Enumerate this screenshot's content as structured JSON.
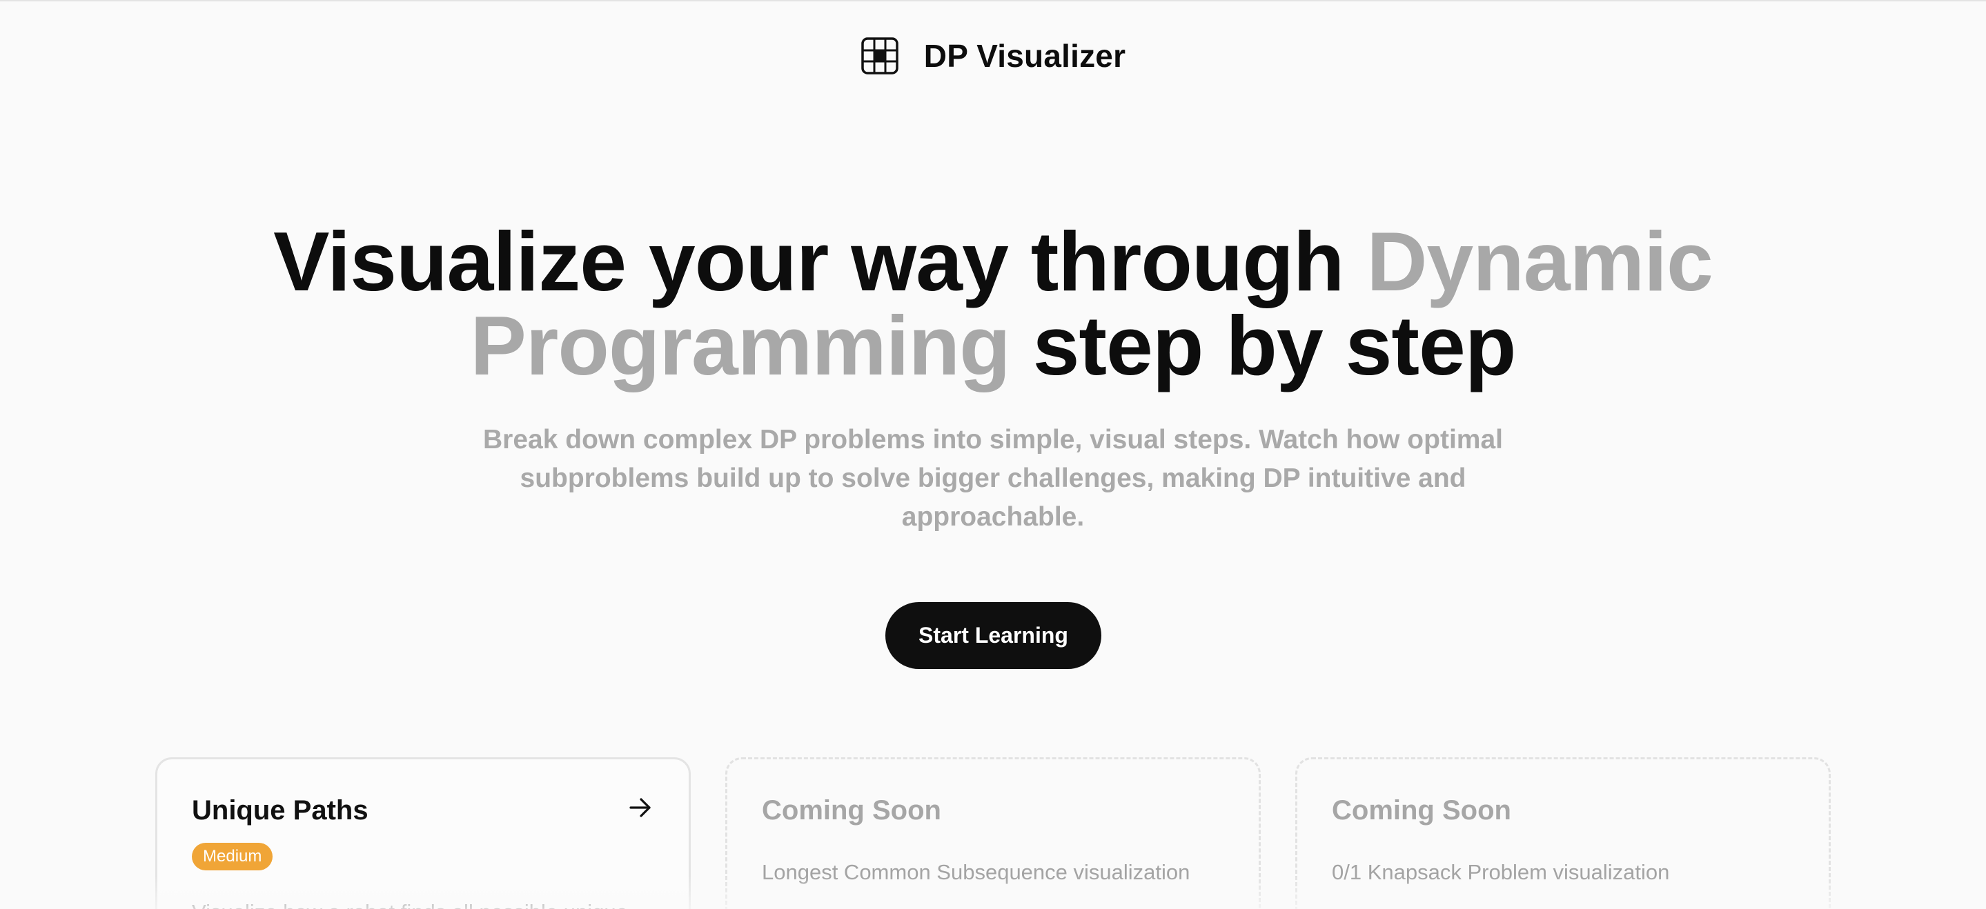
{
  "header": {
    "logo_icon": "grid-icon",
    "title": "DP Visualizer"
  },
  "hero": {
    "title_part1": "Visualize your way through ",
    "title_accent": "Dynamic Programming",
    "title_part2": " step by step",
    "subtitle": "Break down complex DP problems into simple, visual steps. Watch how optimal subproblems build up to solve bigger challenges, making DP intuitive and approachable.",
    "cta_label": "Start Learning"
  },
  "cards": [
    {
      "title": "Unique Paths",
      "badge": "Medium",
      "description": "Visualize how a robot finds all possible unique",
      "icon": "arrow-right-icon"
    },
    {
      "title": "Coming Soon",
      "description": "Longest Common Subsequence visualization"
    },
    {
      "title": "Coming Soon",
      "description": "0/1 Knapsack Problem visualization"
    }
  ],
  "colors": {
    "background": "#fafafa",
    "text": "#0d0d0d",
    "accent_gray": "#a8a8a8",
    "badge_medium": "#f0a537",
    "cta_bg": "#0f0f0f"
  }
}
